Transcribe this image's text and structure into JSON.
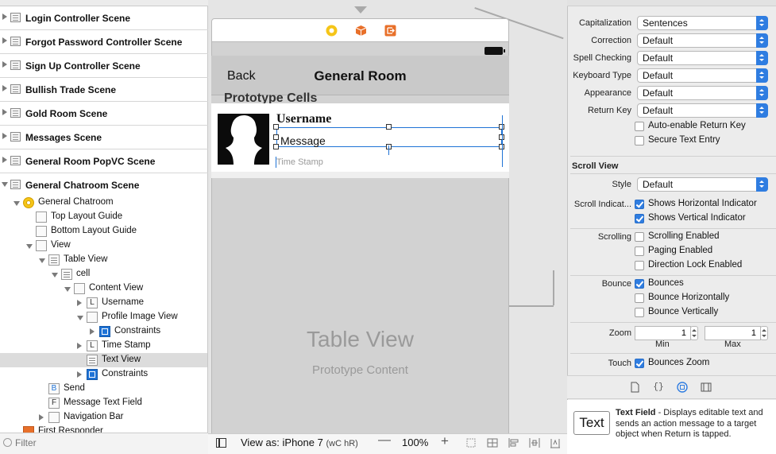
{
  "navigator": {
    "scenes": [
      {
        "label": "Login Controller Scene"
      },
      {
        "label": "Forgot Password Controller Scene"
      },
      {
        "label": "Sign Up Controller Scene"
      },
      {
        "label": "Bullish Trade Scene"
      },
      {
        "label": "Gold Room Scene"
      },
      {
        "label": "Messages Scene"
      },
      {
        "label": "General Room PopVC Scene"
      },
      {
        "label": "General Chatroom Scene"
      }
    ],
    "tree": [
      {
        "label": "General Chatroom"
      },
      {
        "label": "Top Layout Guide"
      },
      {
        "label": "Bottom Layout Guide"
      },
      {
        "label": "View"
      },
      {
        "label": "Table View"
      },
      {
        "label": "cell"
      },
      {
        "label": "Content View"
      },
      {
        "label": "Username",
        "icon": "L"
      },
      {
        "label": "Profile Image View"
      },
      {
        "label": "Constraints"
      },
      {
        "label": "Time Stamp",
        "icon": "L"
      },
      {
        "label": "Text View"
      },
      {
        "label": "Constraints"
      },
      {
        "label": "Send",
        "icon": "B"
      },
      {
        "label": "Message Text Field",
        "icon": "F"
      },
      {
        "label": "Navigation Bar"
      },
      {
        "label": "First Responder"
      }
    ],
    "filter_placeholder": "Filter"
  },
  "canvas": {
    "back_label": "Back",
    "nav_title": "General Room",
    "prototype_cells_label": "Prototype Cells",
    "cell": {
      "username": "Username",
      "message": "Message",
      "timestamp": "Time Stamp"
    },
    "table_view_title": "Table View",
    "table_view_subtitle": "Prototype Content",
    "scene_bar_icons": [
      "view-controller-icon",
      "first-responder-icon",
      "exit-icon"
    ]
  },
  "canvas_bar": {
    "view_as": "View as: iPhone 7",
    "size_class": "(wC hR)",
    "zoom_minus": "—",
    "zoom": "100%",
    "zoom_plus": "+"
  },
  "inspector": {
    "text_input": [
      {
        "label": "Capitalization",
        "value": "Sentences"
      },
      {
        "label": "Correction",
        "value": "Default"
      },
      {
        "label": "Spell Checking",
        "value": "Default"
      },
      {
        "label": "Keyboard Type",
        "value": "Default"
      },
      {
        "label": "Appearance",
        "value": "Default"
      },
      {
        "label": "Return Key",
        "value": "Default"
      }
    ],
    "auto_enable_return_key": "Auto-enable Return Key",
    "secure_text_entry": "Secure Text Entry",
    "scroll_view_header": "Scroll View",
    "style_label": "Style",
    "style_value": "Default",
    "scroll_indicators_label": "Scroll Indicat...",
    "shows_horizontal": "Shows Horizontal Indicator",
    "shows_vertical": "Shows Vertical Indicator",
    "scrolling_label": "Scrolling",
    "scrolling_enabled": "Scrolling Enabled",
    "paging_enabled": "Paging Enabled",
    "direction_lock": "Direction Lock Enabled",
    "bounce_label": "Bounce",
    "bounces": "Bounces",
    "bounce_horizontally": "Bounce Horizontally",
    "bounce_vertically": "Bounce Vertically",
    "zoom_label": "Zoom",
    "zoom_min": "1",
    "zoom_max": "1",
    "min_label": "Min",
    "max_label": "Max",
    "touch_label": "Touch",
    "bounces_zoom": "Bounces Zoom",
    "checks": {
      "auto_enable_return_key": false,
      "secure_text_entry": false,
      "shows_horizontal": true,
      "shows_vertical": true,
      "scrolling_enabled": false,
      "paging_enabled": false,
      "direction_lock": false,
      "bounces": true,
      "bounce_horizontally": false,
      "bounce_vertically": false,
      "bounces_zoom": true
    },
    "library": {
      "thumb": "Text",
      "name": "Text Field",
      "desc": " - Displays editable text and sends an action message to a target object when Return is tapped."
    }
  },
  "colors": {
    "accent": "#2f7de1",
    "selection_blue": "#1f73d6",
    "view_controller_yellow": "#f5c518",
    "scene_icon_orange": "#e8702a"
  }
}
